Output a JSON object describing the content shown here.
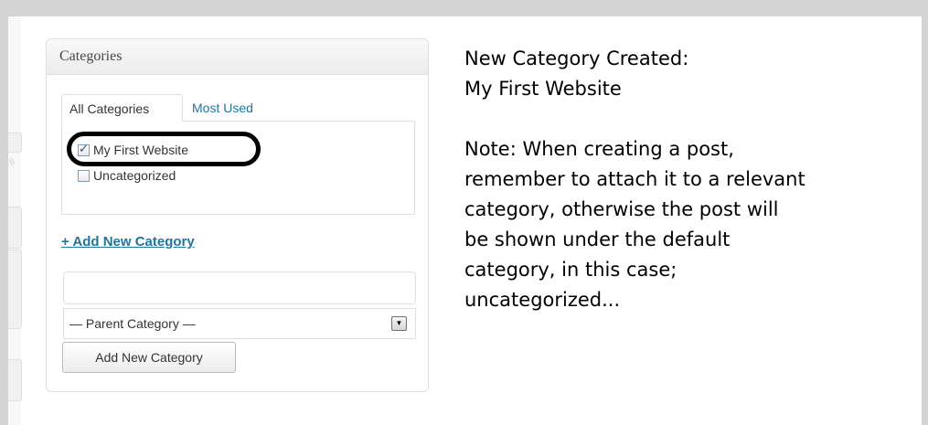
{
  "categories_box": {
    "title": "Categories",
    "tabs": [
      {
        "label": "All Categories",
        "active": true
      },
      {
        "label": "Most Used",
        "active": false
      }
    ],
    "categories": [
      {
        "label": "My First Website",
        "checked": true
      },
      {
        "label": "Uncategorized",
        "checked": false
      }
    ],
    "add_new_link": "+ Add New Category",
    "new_category_input": {
      "value": "",
      "placeholder": ""
    },
    "parent_select": {
      "selected": "— Parent Category —"
    },
    "add_button_label": "Add New Category"
  },
  "annotation": {
    "heading_line1": "New Category Created:",
    "heading_line2": "My First Website",
    "note_lines": [
      "Note: When creating a post,",
      "remember to attach it to a relevant",
      "category, otherwise the post will",
      "be shown under the default",
      "category, in this case;",
      "uncategorized..."
    ]
  },
  "colors": {
    "link": "#21759b",
    "highlight_oval": "#000000",
    "frame": "#d4d4d4"
  },
  "icons": {
    "select_arrow": "chevron-down-icon",
    "checkbox_checked": "checkmark-icon"
  }
}
